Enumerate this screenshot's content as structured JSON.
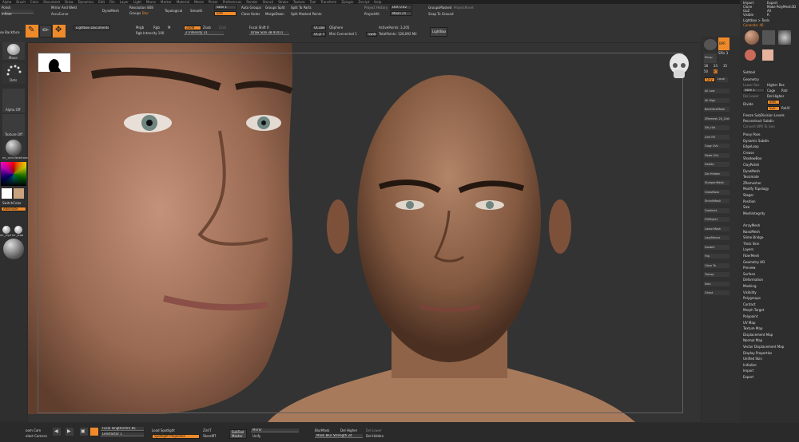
{
  "menu": [
    "Alpha",
    "Brush",
    "Color",
    "Document",
    "Draw",
    "Dynamics",
    "Edit",
    "File",
    "Layer",
    "Light",
    "Macro",
    "Marker",
    "Material",
    "Movie",
    "Picker",
    "Preferences",
    "Render",
    "Stencil",
    "Stroke",
    "Texture",
    "Tool",
    "Transform",
    "Zplugin",
    "Zscript",
    "Help"
  ],
  "topbar": {
    "polish": "Polish",
    "inflate": "Inflate",
    "mirror_weld": "Mirror And Weld",
    "accucurve": "AccuCurve",
    "dynamesh": "DynaMesh",
    "resolution": "Resolution 808",
    "groups": "Groups",
    "blur": "Blur",
    "topological": "Topological",
    "smooth": "Smooth",
    "sdiv": "SDiv 1",
    "smt": "Smt",
    "auto_groups": "Auto Groups",
    "close_holes": "Close Holes",
    "groups_split": "Groups Split",
    "merge_down": "MergeDown",
    "split_to_parts": "Split To Parts",
    "split_masked_points": "Split Masked Points",
    "project_history": "Project History",
    "project_all": "ProjectAll",
    "dist": "Dist 0.02",
    "mean": "Mean 25",
    "group_masked": "GroupsMasked",
    "project_reset": "ProjectReset",
    "snap_to_ground": "Snap To Ground",
    "lightbox_documents": "Lightbox Documents",
    "mrgb": "Mrgb",
    "rgb": "Rgb",
    "m": "M",
    "zadd": "Zadd",
    "zsub": "Zsub",
    "zcut": "Zcut",
    "rgb_intensity": "Rgb Intensity 100",
    "z_intensity": "Z Intensity 31",
    "focal_shift": "Focal Shift 0",
    "draw_size": "Draw Size 38.91411",
    "qcube": "QCube",
    "qcyl": "QCyl Y",
    "qsphere": "QSphere",
    "mini_connected": "Mini Connected 1",
    "active_points": "ActivePoints: 3,205",
    "total_points": "TotalPoints: 128,092 Mil",
    "switch": "Switch",
    "lightbox": "LightBox"
  },
  "leftshelf": {
    "no_backface": "oe Backface",
    "move": "Move",
    "dots": "Dots",
    "alpha_off": "Alpha Off",
    "texture_off": "Texture Off",
    "material": "mr_clint Wireframe",
    "switch_color": "SwitchColor",
    "alternate": "Alternate",
    "material2": "mr_clyd mr_stab"
  },
  "rightshelf": {
    "brush": "BPR",
    "spix": "SPix 3",
    "persp": "Persp",
    "xyz": "Floor",
    "local": "Local",
    "numbers": [
      "18",
      "24",
      "35",
      "50",
      "85"
    ],
    "qxyz": "Qxy",
    "items": [
      "All Low",
      "All High",
      "BackfaceMask",
      "ZRemesh 2X_Clell",
      "DH_Hid",
      "Line Fill",
      "Copy UVs",
      "Paste UVs",
      "Delete",
      "Del Hidden",
      "SharpenMesh",
      "GrowMask",
      "ShrinkMask",
      "Gradient",
      "FillObject",
      "Lasso Mask",
      "LazyMouse",
      "Double",
      "Flip",
      "Clear To",
      "Transp",
      "Solo",
      "Ghost"
    ]
  },
  "rightpanel": {
    "top": [
      "Import",
      "Export",
      "Clone",
      "Make PolyMesh3D",
      "GoZ",
      "All",
      "Visible",
      "R"
    ],
    "lightbox_tools": "Lightbox > Tools",
    "current_tool": "Cunanda: 46",
    "tools": [
      "Cylinder SimpleB",
      "Cunanda",
      "Cunanda",
      "Cylinder3D",
      "PolyMesh"
    ],
    "subtool": "Subtool",
    "geometry": "Geometry",
    "lower_res": "Lower Res",
    "higher_res": "Higher Res",
    "sdiv": "SDiv 1",
    "cage": "Cage",
    "rstr": "Rstr",
    "del_lower": "Del Lower",
    "del_higher": "Del Higher",
    "divide": "Divide",
    "smt": "Smt",
    "suv": "Suv",
    "reuv": "ReUV",
    "freeze_subdiv": "Freeze SubDivision Levels",
    "reconstruct_subdiv": "Reconstruct Subdiv",
    "convert_bpr": "Convert BPR To Geo",
    "items": [
      "Proxy Pose",
      "Dynamic Subdiv",
      "EdgeLoop",
      "Crease",
      "ShadowBox",
      "ClayPolish",
      "DynaMesh",
      "Tessimate",
      "ZRemesher",
      "Modify Topology",
      "Stager",
      "Position",
      "Size",
      "MeshIntegrity"
    ],
    "items2": [
      "ArrayMesh",
      "NanoMesh",
      "Slime Bridge",
      "Thick Skin",
      "Layers",
      "FiberMesh",
      "Geometry HD",
      "Preview",
      "Surface",
      "Deformation",
      "Masking",
      "Visibility",
      "Polygroups",
      "Contact",
      "Morph Target",
      "Polypaint",
      "UV Map",
      "Texture Map",
      "Displacement Map",
      "Normal Map",
      "Vector Displacement Map",
      "Display Properties",
      "Unified Skin",
      "Initialize",
      "Import",
      "Export"
    ]
  },
  "bottombar": {
    "zoom_cam": "oom Cam",
    "select_camera": "elect Camera",
    "focal_length": "Focal length(mm) 85",
    "lens_factor": "Lensfactor 1",
    "load_spotlight": "Load Spotlight",
    "spotlight_projection": "Spotlight Projection",
    "zintf": "ZintT",
    "store_mt": "StoreMT",
    "subtool_master": "SubTool Master",
    "mirror": "Mirror",
    "unify": "Unify",
    "blur_mask": "BlurMask",
    "mask_blur_strength": "Mask Blur Strength 24",
    "del_higher": "Del Higher",
    "del_hidden": "Del Hidden",
    "del_lower": "Del Lower"
  },
  "colors": {
    "accent": "#ef8a2a",
    "bg": "#2b2b2b",
    "viewport": "#333333"
  }
}
